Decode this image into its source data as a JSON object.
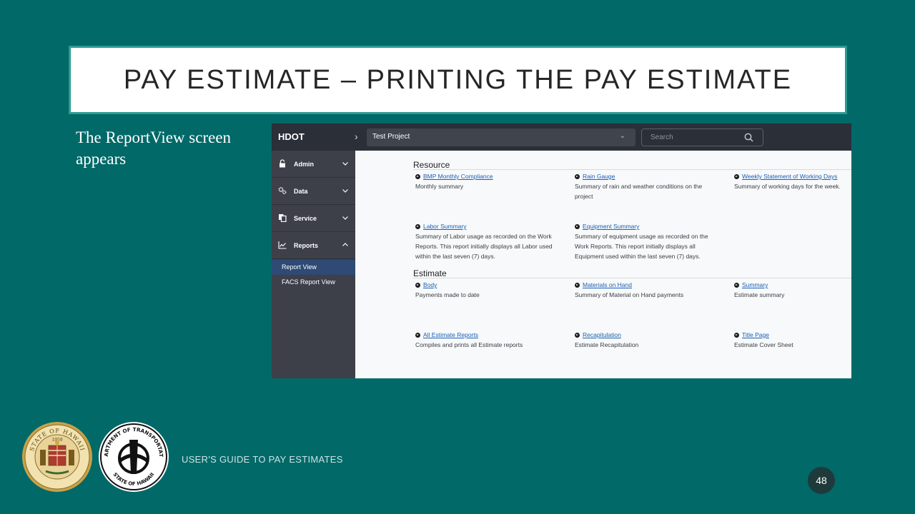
{
  "slide": {
    "title": "PAY ESTIMATE – PRINTING THE PAY ESTIMATE",
    "caption": "The ReportView screen appears",
    "footer": "USER'S GUIDE TO PAY ESTIMATES",
    "page_number": "48",
    "colors": {
      "background": "#016968",
      "title_border": "#2c9a92"
    }
  },
  "seals": {
    "state": {
      "top_text": "STATE OF HAWAII",
      "year": "1959"
    },
    "dot": {
      "top_text": "DEPARTMENT OF TRANSPORTATION",
      "bottom_text": "STATE OF HAWAII"
    }
  },
  "app": {
    "brand": "HDOT",
    "project_select": {
      "value": "Test Project"
    },
    "search": {
      "placeholder": "Search"
    },
    "sidebar": {
      "items": [
        {
          "label": "Admin",
          "icon": "lock-icon",
          "expanded": false
        },
        {
          "label": "Data",
          "icon": "gears-icon",
          "expanded": false
        },
        {
          "label": "Service",
          "icon": "copy-icon",
          "expanded": false
        },
        {
          "label": "Reports",
          "icon": "chart-line-icon",
          "expanded": true
        }
      ],
      "sub_items": [
        {
          "label": "Report View",
          "active": true
        },
        {
          "label": "FACS Report View",
          "active": false
        }
      ]
    },
    "sections": [
      {
        "heading": "Resource",
        "reports": [
          {
            "link": "BMP Monthly Compliance",
            "desc": "Monthly summary"
          },
          {
            "link": "Rain Gauge",
            "desc": "Summary of rain and weather conditions on the project"
          },
          {
            "link": "Weekly Statement of Working Days",
            "desc": "Summary of working days for the week."
          },
          {
            "link": "Labor Summary",
            "desc": "Summary of Labor usage as recorded on the Work Reports. This report initially displays all Labor used within the last seven (7) days."
          },
          {
            "link": "Equipment Summary",
            "desc": "Summary of equipment usage as recorded on the Work Reports. This report initially displays all Equipment used within the last seven (7) days."
          }
        ]
      },
      {
        "heading": "Estimate",
        "reports": [
          {
            "link": "Body",
            "desc": "Payments made to date"
          },
          {
            "link": "Materials on Hand",
            "desc": "Summary of Material on Hand payments"
          },
          {
            "link": "Summary",
            "desc": "Estimate summary"
          },
          {
            "link": "All Estimate Reports",
            "desc": "Compiles and prints all Estimate reports"
          },
          {
            "link": "Recapitulation",
            "desc": "Estimate Recapitulation"
          },
          {
            "link": "Title Page",
            "desc": "Estimate Cover Sheet"
          }
        ]
      }
    ]
  }
}
